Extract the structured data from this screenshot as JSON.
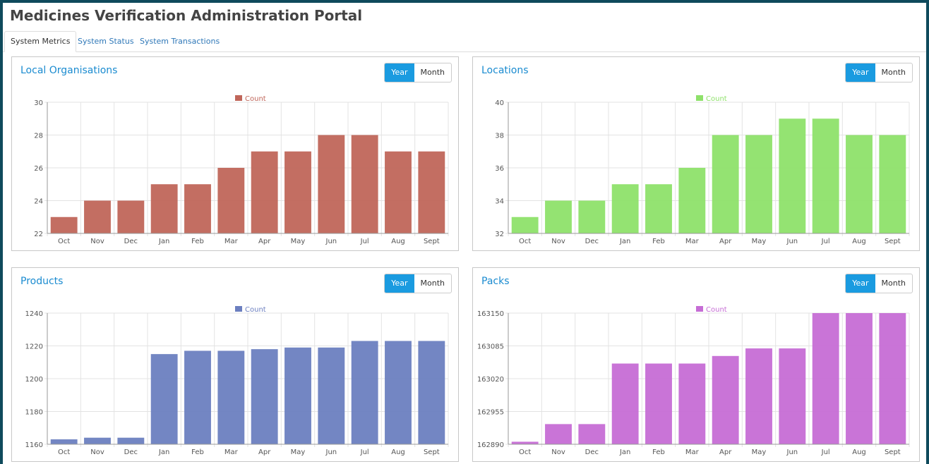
{
  "app": {
    "title": "Medicines Verification Administration Portal"
  },
  "tabs": [
    {
      "label": "System Metrics",
      "active": true
    },
    {
      "label": "System Status",
      "active": false
    },
    {
      "label": "System Transactions",
      "active": false
    }
  ],
  "toggle": {
    "year_label": "Year",
    "month_label": "Month",
    "selected": "Year"
  },
  "chart_data": [
    {
      "type": "bar",
      "title": "Local Organisations",
      "color": "#c0665a",
      "categories": [
        "Oct",
        "Nov",
        "Dec",
        "Jan",
        "Feb",
        "Mar",
        "Apr",
        "May",
        "Jun",
        "Jul",
        "Aug",
        "Sept"
      ],
      "series": [
        {
          "name": "Count",
          "values": [
            23,
            24,
            24,
            25,
            25,
            26,
            27,
            27,
            28,
            28,
            27,
            27
          ]
        }
      ],
      "ylim": [
        22,
        30
      ],
      "yticks": [
        22,
        24,
        26,
        28,
        30
      ],
      "grid": true,
      "legend": "top-center"
    },
    {
      "type": "bar",
      "title": "Locations",
      "color": "#8ee16a",
      "categories": [
        "Oct",
        "Nov",
        "Dec",
        "Jan",
        "Feb",
        "Mar",
        "Apr",
        "May",
        "Jun",
        "Jul",
        "Aug",
        "Sept"
      ],
      "series": [
        {
          "name": "Count",
          "values": [
            33,
            34,
            34,
            35,
            35,
            36,
            38,
            38,
            39,
            39,
            38,
            38
          ]
        }
      ],
      "ylim": [
        32,
        40
      ],
      "yticks": [
        32,
        34,
        36,
        38,
        40
      ],
      "grid": true,
      "legend": "top-center"
    },
    {
      "type": "bar",
      "title": "Products",
      "color": "#6c7fc0",
      "categories": [
        "Oct",
        "Nov",
        "Dec",
        "Jan",
        "Feb",
        "Mar",
        "Apr",
        "May",
        "Jun",
        "Jul",
        "Aug",
        "Sept"
      ],
      "series": [
        {
          "name": "Count",
          "values": [
            1163,
            1164,
            1164,
            1215,
            1217,
            1217,
            1218,
            1219,
            1219,
            1223,
            1223,
            1223
          ]
        }
      ],
      "ylim": [
        1160,
        1240
      ],
      "yticks": [
        1160,
        1180,
        1200,
        1220,
        1240
      ],
      "grid": true,
      "legend": "top-center"
    },
    {
      "type": "bar",
      "title": "Packs",
      "color": "#c66dd5",
      "categories": [
        "Oct",
        "Nov",
        "Dec",
        "Jan",
        "Feb",
        "Mar",
        "Apr",
        "May",
        "Jun",
        "Jul",
        "Aug",
        "Sept"
      ],
      "series": [
        {
          "name": "Count",
          "values": [
            162895,
            162930,
            162930,
            163050,
            163050,
            163050,
            163065,
            163080,
            163080,
            163150,
            163150,
            163150
          ]
        }
      ],
      "ylim": [
        162890,
        163150
      ],
      "yticks": [
        162890,
        162955,
        163020,
        163085,
        163150
      ],
      "grid": true,
      "legend": "top-center"
    }
  ]
}
